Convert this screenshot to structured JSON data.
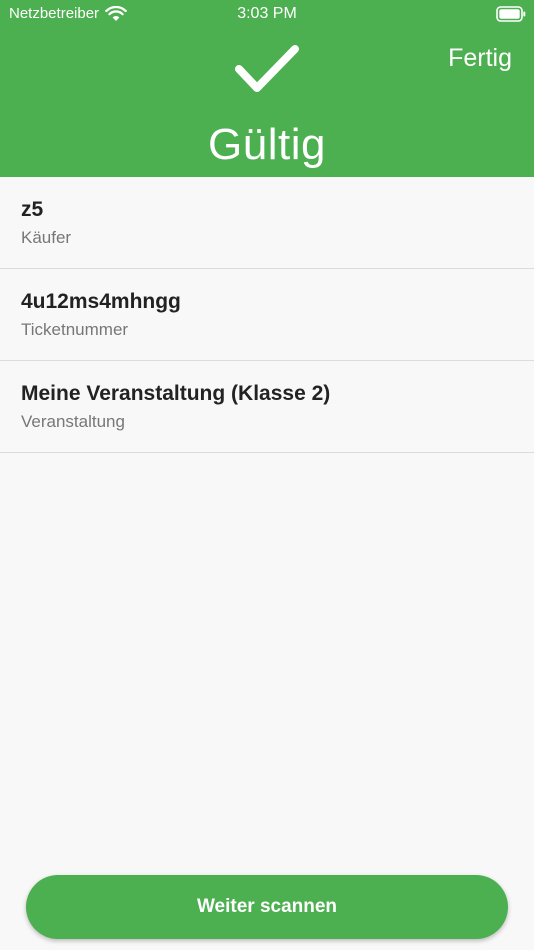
{
  "status_bar": {
    "carrier": "Netzbetreiber",
    "time": "3:03 PM"
  },
  "header": {
    "done_label": "Fertig",
    "status": "Gültig",
    "background_color": "#4caf50",
    "icon": "check-icon"
  },
  "details": [
    {
      "value": "z5",
      "label": "Käufer"
    },
    {
      "value": "4u12ms4mhngg",
      "label": "Ticketnummer"
    },
    {
      "value": "Meine Veranstaltung (Klasse 2)",
      "label": "Veranstaltung"
    }
  ],
  "footer": {
    "continue_label": "Weiter scannen"
  }
}
